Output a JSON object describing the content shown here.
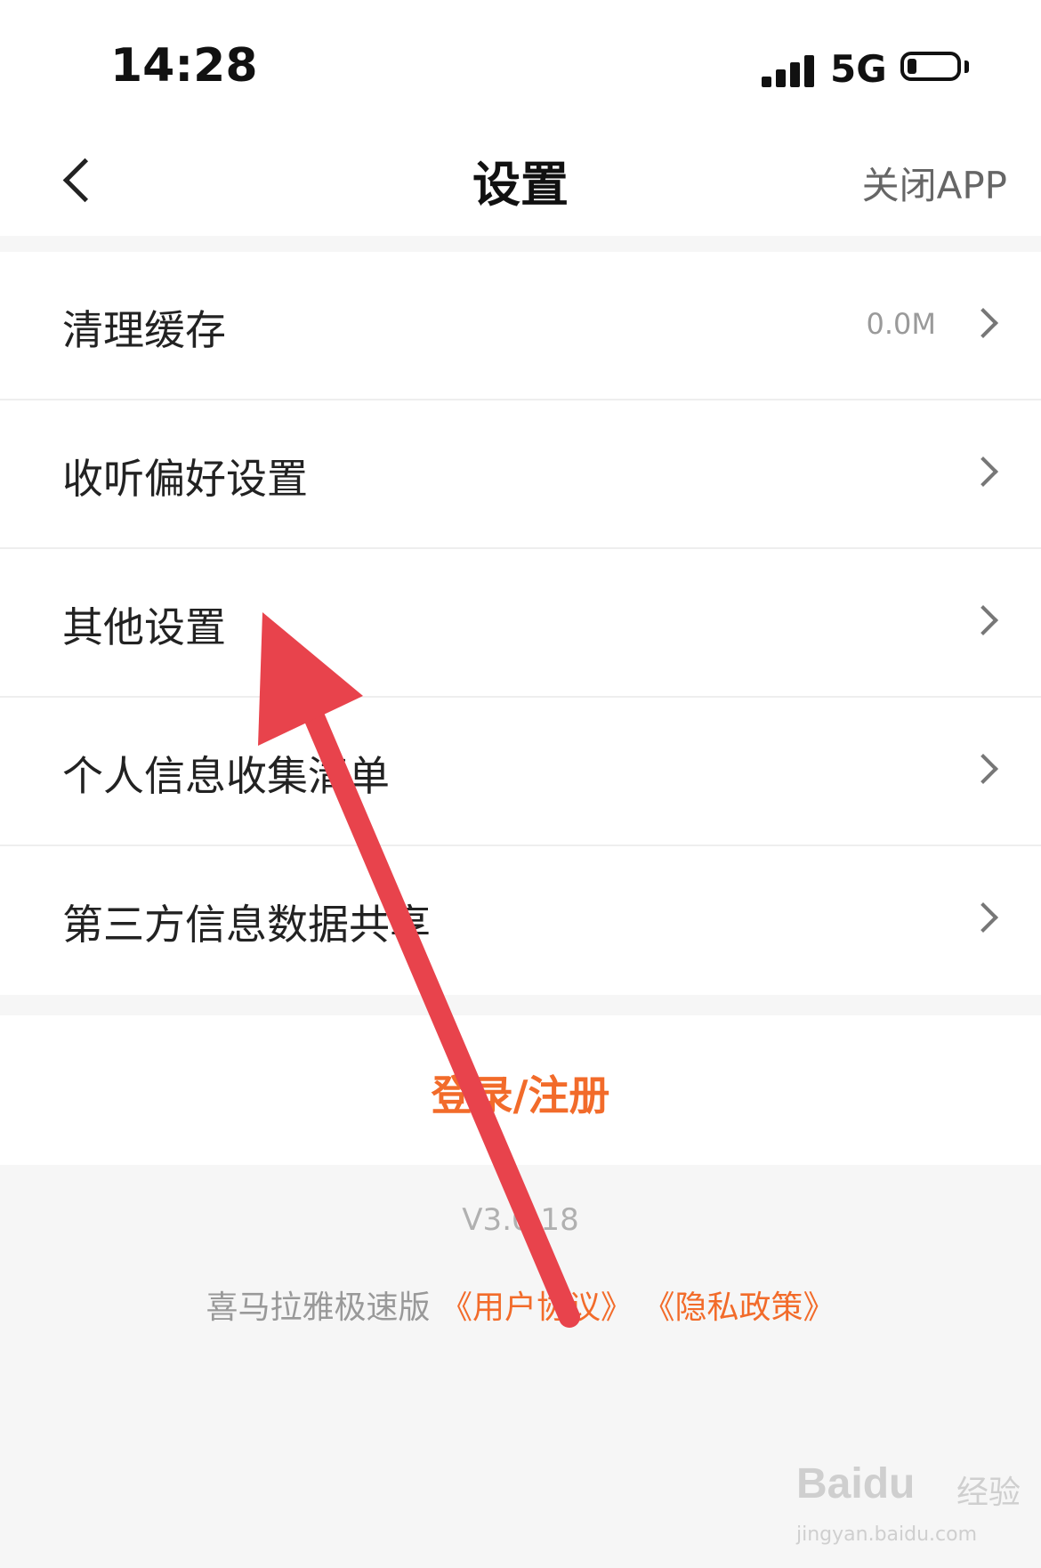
{
  "status": {
    "time": "14:28",
    "network": "5G"
  },
  "nav": {
    "title": "设置",
    "close_app": "关闭APP"
  },
  "settings": {
    "items": [
      {
        "label": "清理缓存",
        "value": "0.0M"
      },
      {
        "label": "收听偏好设置"
      },
      {
        "label": "其他设置"
      },
      {
        "label": "个人信息收集清单"
      },
      {
        "label": "第三方信息数据共享"
      }
    ]
  },
  "login": {
    "label": "登录/注册"
  },
  "footer": {
    "version": "V3.0.18",
    "app_name": "喜马拉雅极速版",
    "user_agreement": "《用户协议》",
    "privacy_policy": "《隐私政策》"
  },
  "watermark": {
    "brand": "Baidu",
    "suffix": "经验",
    "url": "jingyan.baidu.com"
  },
  "colors": {
    "accent": "#f26b2a",
    "annotation_arrow": "#e8434c",
    "background": "#f6f6f6"
  }
}
